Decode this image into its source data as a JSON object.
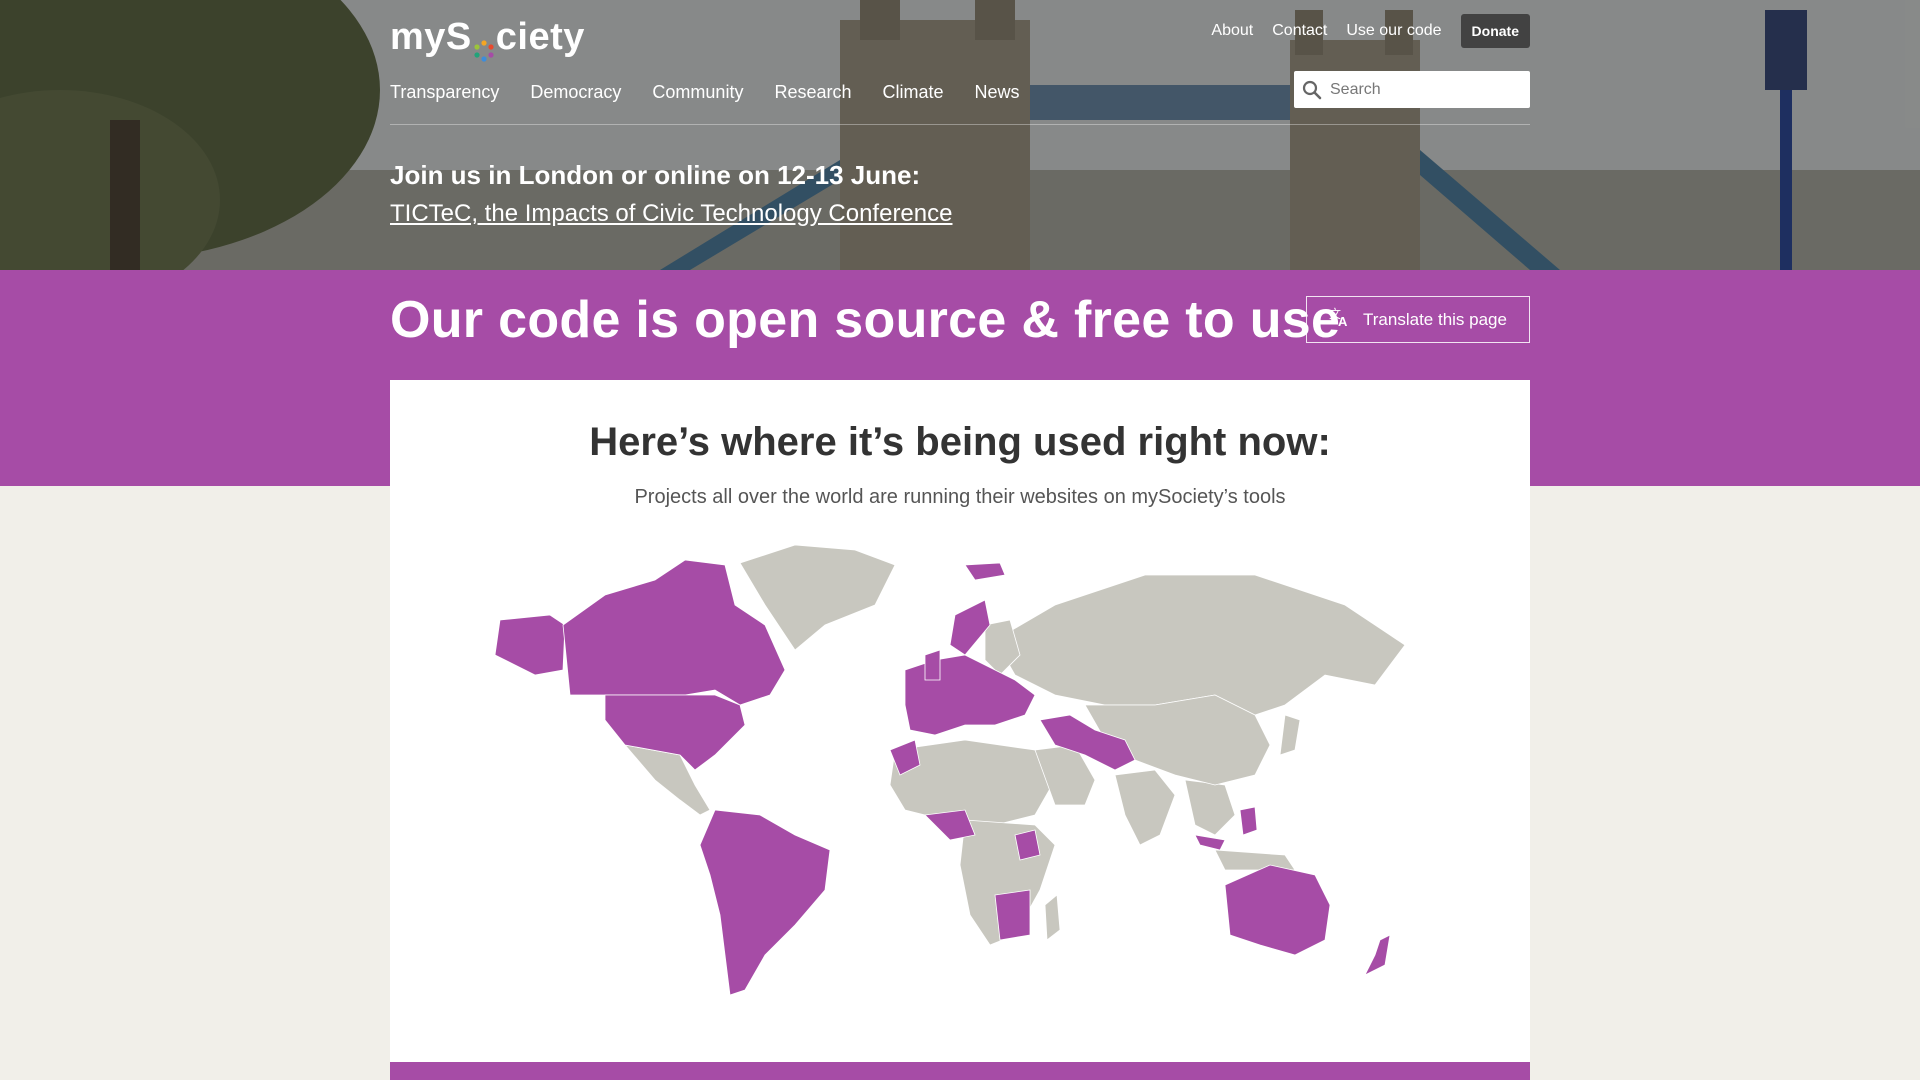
{
  "header": {
    "logo_text_left": "myS",
    "logo_text_right": "ciety",
    "utility_links": [
      "About",
      "Contact",
      "Use our code"
    ],
    "donate_label": "Donate",
    "nav": [
      "Transparency",
      "Democracy",
      "Community",
      "Research",
      "Climate",
      "News"
    ],
    "search_placeholder": "Search"
  },
  "banner": {
    "title": "Join us in London or online on 12-13 June:",
    "link_text": "TICTeC, the Impacts of Civic Technology Conference"
  },
  "hero_section": {
    "heading": "Our code is open source & free to use",
    "translate_label": "Translate this page"
  },
  "map_section": {
    "title": "Here’s where it’s being used right now:",
    "subtitle": "Projects all over the world are running their websites on mySociety’s tools"
  },
  "colors": {
    "brand_purple": "#a64ca6",
    "map_land": "#c8c7bf",
    "map_highlight": "#a64ca6",
    "page_bg": "#f1efe9"
  },
  "icons": [
    "search-icon",
    "translate-icon",
    "logo-dot-icon"
  ]
}
